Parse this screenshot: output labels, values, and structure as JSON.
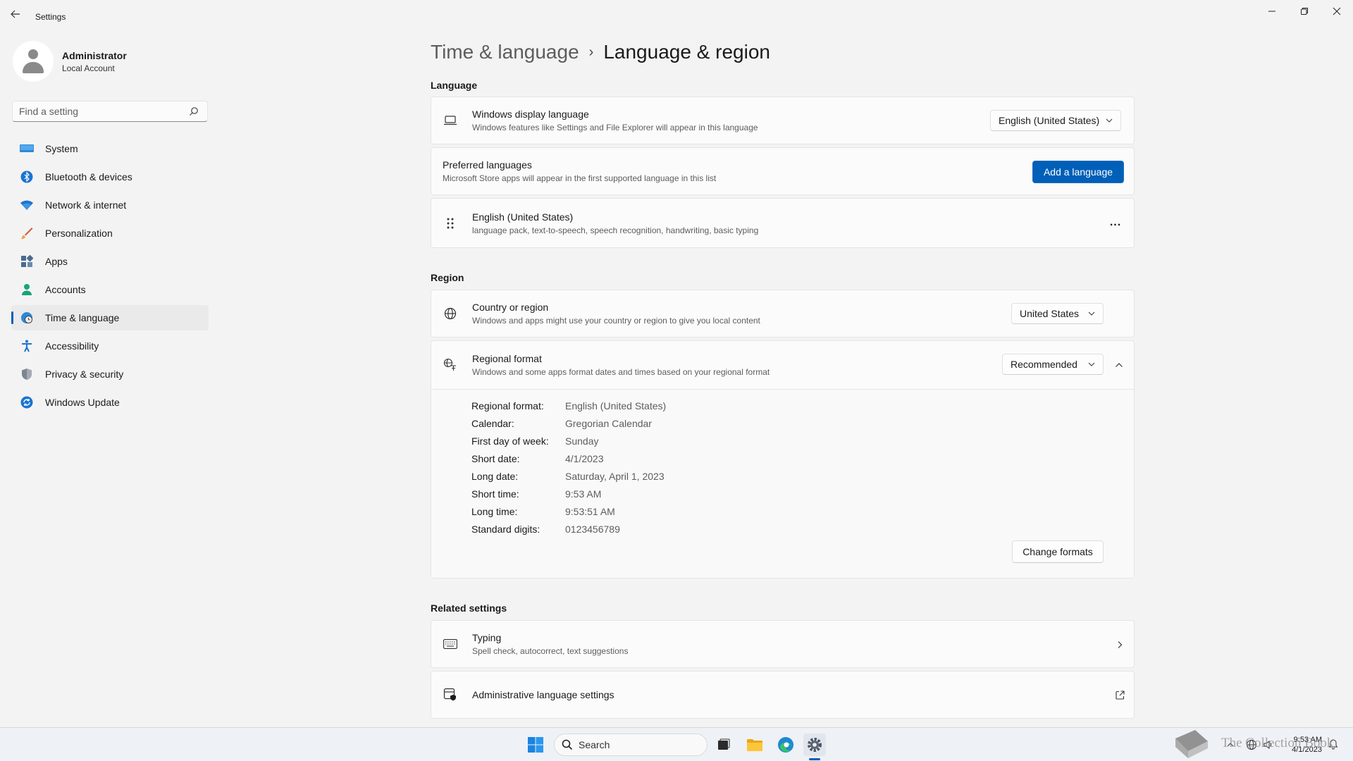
{
  "window": {
    "title": "Settings",
    "controls": [
      "minimize",
      "restore",
      "close"
    ]
  },
  "profile": {
    "name": "Administrator",
    "account_type": "Local Account"
  },
  "search": {
    "placeholder": "Find a setting"
  },
  "sidebar": {
    "items": [
      {
        "label": "System",
        "icon": "monitor-icon",
        "active": false
      },
      {
        "label": "Bluetooth & devices",
        "icon": "bluetooth-icon",
        "active": false
      },
      {
        "label": "Network & internet",
        "icon": "wifi-icon",
        "active": false
      },
      {
        "label": "Personalization",
        "icon": "brush-icon",
        "active": false
      },
      {
        "label": "Apps",
        "icon": "apps-icon",
        "active": false
      },
      {
        "label": "Accounts",
        "icon": "person-icon",
        "active": false
      },
      {
        "label": "Time & language",
        "icon": "globe-clock-icon",
        "active": true
      },
      {
        "label": "Accessibility",
        "icon": "accessibility-icon",
        "active": false
      },
      {
        "label": "Privacy & security",
        "icon": "shield-icon",
        "active": false
      },
      {
        "label": "Windows Update",
        "icon": "update-icon",
        "active": false
      }
    ]
  },
  "breadcrumb": {
    "parent": "Time & language",
    "separator": "›",
    "current": "Language & region"
  },
  "language": {
    "heading": "Language",
    "display_language": {
      "title": "Windows display language",
      "description": "Windows features like Settings and File Explorer will appear in this language",
      "value": "English (United States)"
    },
    "preferred": {
      "title": "Preferred languages",
      "description": "Microsoft Store apps will appear in the first supported language in this list",
      "button": "Add a language"
    },
    "installed": {
      "title": "English (United States)",
      "description": "language pack, text-to-speech, speech recognition, handwriting, basic typing",
      "more": "..."
    }
  },
  "region": {
    "heading": "Region",
    "country": {
      "title": "Country or region",
      "description": "Windows and apps might use your country or region to give you local content",
      "value": "United States"
    },
    "format": {
      "title": "Regional format",
      "description": "Windows and some apps format dates and times based on your regional format",
      "value": "Recommended",
      "expanded": true,
      "details": [
        {
          "label": "Regional format:",
          "value": "English (United States)"
        },
        {
          "label": "Calendar:",
          "value": "Gregorian Calendar"
        },
        {
          "label": "First day of week:",
          "value": "Sunday"
        },
        {
          "label": "Short date:",
          "value": "4/1/2023"
        },
        {
          "label": "Long date:",
          "value": "Saturday, April 1, 2023"
        },
        {
          "label": "Short time:",
          "value": "9:53 AM"
        },
        {
          "label": "Long time:",
          "value": "9:53:51 AM"
        },
        {
          "label": "Standard digits:",
          "value": "0123456789"
        }
      ],
      "change_button": "Change formats"
    }
  },
  "related": {
    "heading": "Related settings",
    "typing": {
      "title": "Typing",
      "description": "Spell check, autocorrect, text suggestions"
    },
    "admin": {
      "title": "Administrative language settings"
    }
  },
  "taskbar": {
    "search_label": "Search",
    "clock_time": "9:53 AM",
    "clock_date": "4/1/2023"
  },
  "watermark": {
    "text": "The Collection Book"
  },
  "colors": {
    "accent": "#005fb8",
    "background": "#f3f3f3",
    "card": "#fbfbfb"
  }
}
